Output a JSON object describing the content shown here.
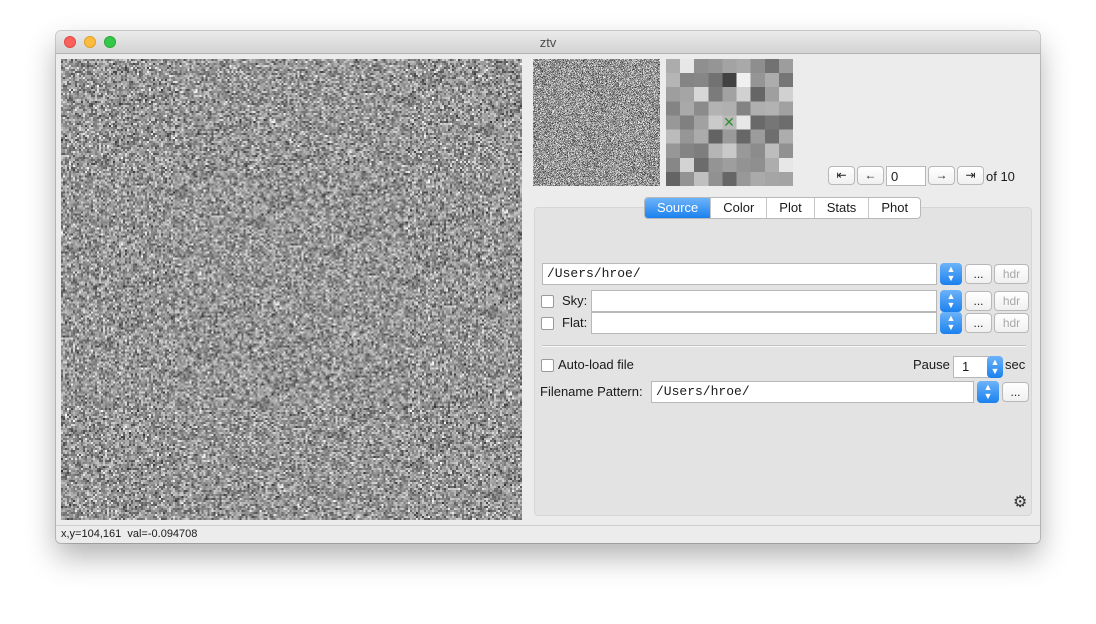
{
  "window": {
    "title": "ztv"
  },
  "frame_nav": {
    "first": "⇤",
    "prev": "←",
    "value": "0",
    "next": "→",
    "last": "⇥",
    "of_label": "of 10"
  },
  "tabs": [
    "Source",
    "Color",
    "Plot",
    "Stats",
    "Phot"
  ],
  "active_tab": "Source",
  "source": {
    "path": "/Users/hroe/",
    "browse": "...",
    "hdr": "hdr",
    "sky_label": "Sky:",
    "sky_path": "",
    "flat_label": "Flat:",
    "flat_path": "",
    "autoload_label": "Auto-load file",
    "pause_label": "Pause",
    "pause_value": "1",
    "pause_unit": "sec",
    "pattern_label": "Filename Pattern:",
    "pattern_value": "/Users/hroe/"
  },
  "status": {
    "coords": "x,y=104,161",
    "value": "val=-0.094708"
  },
  "icons": {
    "stepper": "up-down-chevron",
    "gear": "gear-icon",
    "crosshair": "x-mark"
  },
  "colors": {
    "accent": "#1b81ee",
    "panel": "#e3e3e3",
    "window": "#ececec"
  }
}
